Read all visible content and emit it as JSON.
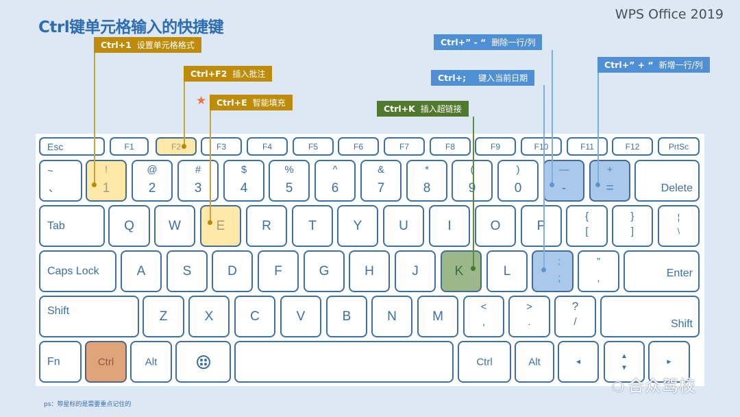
{
  "header": {
    "title": "Ctrl键单元格输入的快捷键",
    "brand": "WPS Office 2019"
  },
  "footnote": "ps：带星标的是需要重点记住的",
  "watermark": {
    "icon": "wechat-icon",
    "text": "合众驾校"
  },
  "colors": {
    "background": "#dde8f5",
    "key_border": "#3a6fa7",
    "title": "#2d6cb0",
    "callout_gold": "#be8c0a",
    "callout_blue": "#4f90d4",
    "callout_green": "#52782d",
    "highlight_yellow": "#fde8a8",
    "highlight_blue": "#a9c8ea",
    "highlight_green": "#9cb88a",
    "highlight_ctrl": "#e0a47a",
    "star": "#e8773a"
  },
  "callouts": [
    {
      "combo": "Ctrl+1",
      "desc": "设置单元格格式",
      "color": "gold",
      "target_key": "1",
      "starred": false
    },
    {
      "combo": "Ctrl+F2",
      "desc": "插入批注",
      "color": "gold",
      "target_key": "F2",
      "starred": false
    },
    {
      "combo": "Ctrl+E",
      "desc": "智能填充",
      "color": "gold",
      "target_key": "E",
      "starred": true
    },
    {
      "combo": "Ctrl+K",
      "desc": "插入超链接",
      "color": "green",
      "target_key": "K",
      "starred": false
    },
    {
      "combo": "Ctrl+” - “",
      "desc": "删除一行/列",
      "color": "blue",
      "target_key": "-",
      "starred": false
    },
    {
      "combo": "Ctrl+;",
      "desc": "键入当前日期",
      "color": "blue",
      "target_key": ";",
      "starred": false
    },
    {
      "combo": "Ctrl+” + “",
      "desc": "新增一行/列",
      "color": "blue",
      "target_key": "=",
      "starred": false
    }
  ],
  "keyboard": {
    "fn_row": [
      "Esc",
      "F1",
      "F2",
      "F3",
      "F4",
      "F5",
      "F6",
      "F7",
      "F8",
      "F9",
      "F10",
      "F11",
      "F12",
      "PrtSc"
    ],
    "number_row": [
      {
        "top": "~",
        "bottom": "、"
      },
      {
        "top": "!",
        "bottom": "1"
      },
      {
        "top": "@",
        "bottom": "2"
      },
      {
        "top": "#",
        "bottom": "3"
      },
      {
        "top": "$",
        "bottom": "4"
      },
      {
        "top": "%",
        "bottom": "5"
      },
      {
        "top": "^",
        "bottom": "6"
      },
      {
        "top": "&",
        "bottom": "7"
      },
      {
        "top": "*",
        "bottom": "8"
      },
      {
        "top": "(",
        "bottom": "9"
      },
      {
        "top": ")",
        "bottom": "0"
      },
      {
        "top": "—",
        "bottom": "-"
      },
      {
        "top": "+",
        "bottom": "="
      },
      {
        "label": "Delete"
      }
    ],
    "qwerty_row": [
      "Tab",
      "Q",
      "W",
      "E",
      "R",
      "T",
      "Y",
      "U",
      "I",
      "O",
      "P",
      {
        "top": "{",
        "bottom": "["
      },
      {
        "top": "}",
        "bottom": "]"
      },
      {
        "top": "¦",
        "bottom": "\\"
      }
    ],
    "home_row": [
      "Caps Lock",
      "A",
      "S",
      "D",
      "F",
      "G",
      "H",
      "J",
      "K",
      "L",
      {
        "top": ":",
        "bottom": ";"
      },
      {
        "top": "”",
        "bottom": ","
      },
      "Enter"
    ],
    "shift_row": [
      "Shift",
      "Z",
      "X",
      "C",
      "V",
      "B",
      "N",
      "M",
      {
        "top": "<",
        "bottom": ","
      },
      {
        "top": ">",
        "bottom": "."
      },
      {
        "top": "?",
        "bottom": "/"
      },
      "Shift"
    ],
    "bottom_row": [
      "Fn",
      "Ctrl",
      "Alt",
      "windows-key-icon",
      "",
      "Ctrl",
      "Alt",
      "◄",
      "▲▼",
      "►"
    ],
    "arrows": {
      "left": "◄",
      "up": "▲",
      "down": "▼",
      "right": "►"
    }
  }
}
